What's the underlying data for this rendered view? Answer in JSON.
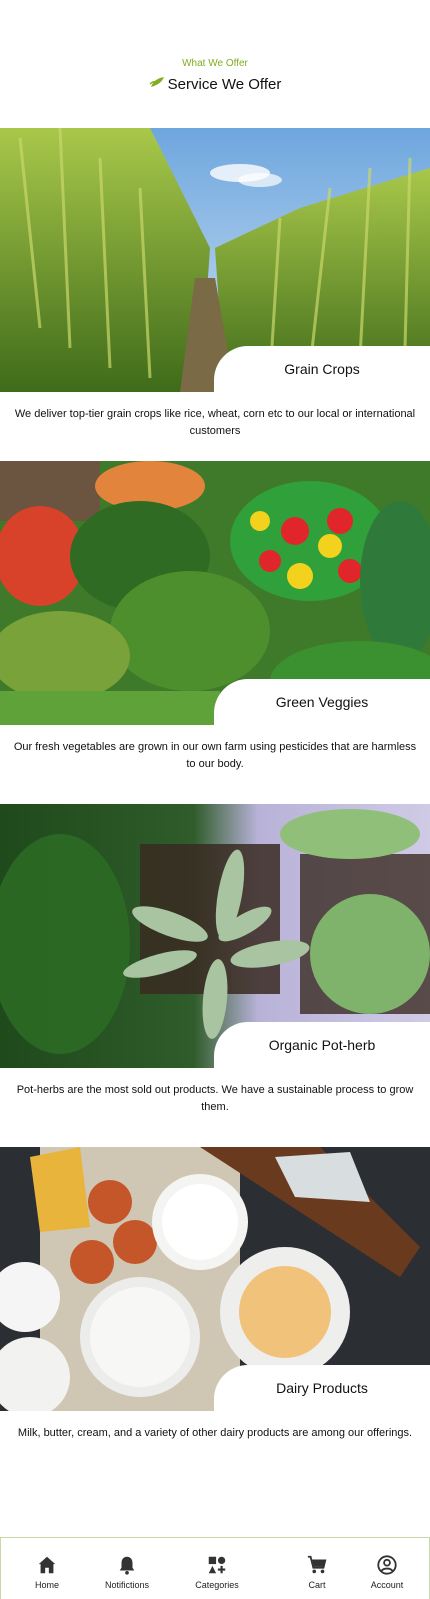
{
  "header": {
    "eyebrow": "What We Offer",
    "title": "Service We Offer"
  },
  "services": [
    {
      "name": "Grain Crops",
      "description": "We deliver top-tier grain crops like rice, wheat, corn etc to our local or international customers"
    },
    {
      "name": "Green Veggies",
      "description": "Our fresh vegetables are grown in our own farm using pesticides that are harmless to our body."
    },
    {
      "name": "Organic Pot-herb",
      "description": "Pot-herbs are the most sold out products. We have a sustainable process to grow them."
    },
    {
      "name": "Dairy Products",
      "description": "Milk, butter, cream, and a variety of other dairy products are among our offerings."
    }
  ],
  "nav": {
    "items": [
      {
        "label": "Home",
        "icon": "home-icon"
      },
      {
        "label": "Notifictions",
        "icon": "bell-icon"
      },
      {
        "label": "Categories",
        "icon": "categories-icon"
      },
      {
        "label": "Cart",
        "icon": "cart-icon"
      },
      {
        "label": "Account",
        "icon": "account-icon"
      }
    ]
  },
  "colors": {
    "accent": "#7fae1f",
    "nav_border": "#c8d7a8"
  }
}
